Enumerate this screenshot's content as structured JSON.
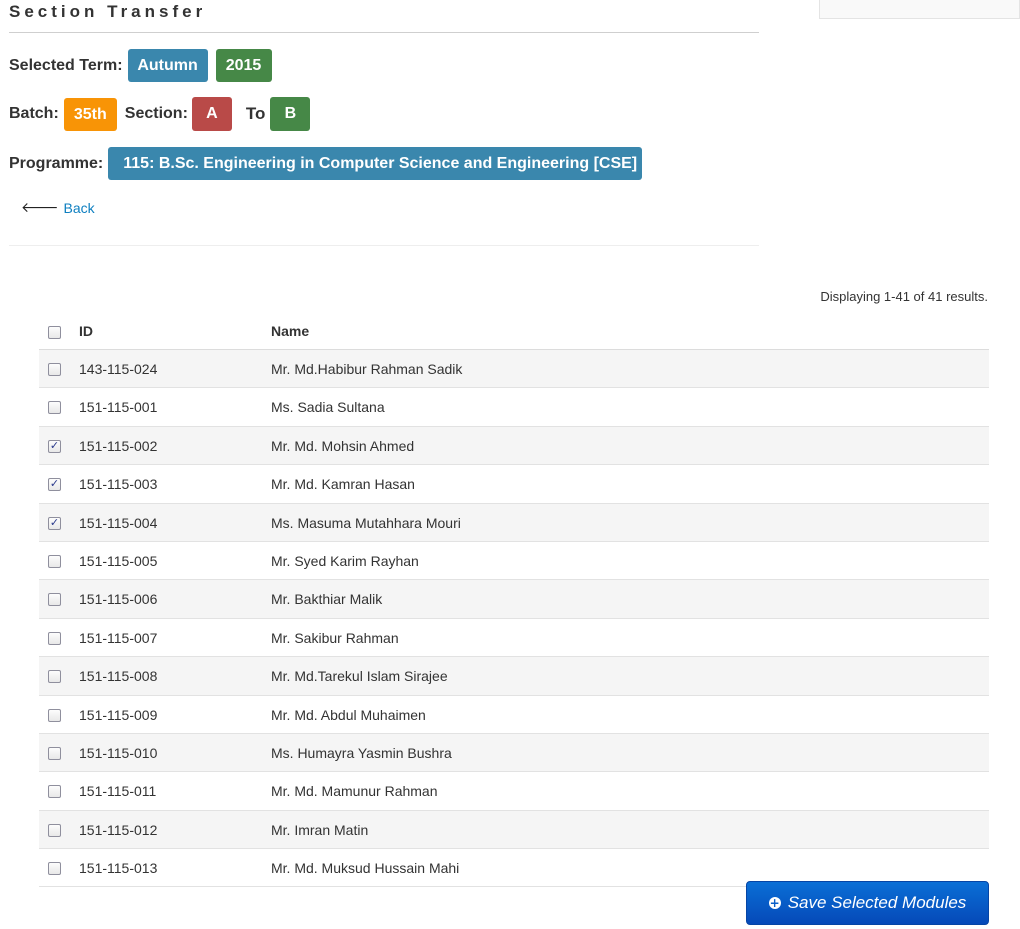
{
  "page": {
    "title": "Section Transfer"
  },
  "term": {
    "label": "Selected Term:",
    "season": "Autumn",
    "year": "2015"
  },
  "batch": {
    "label": "Batch:",
    "value": "35th",
    "section_label": "Section:",
    "section_from": "A",
    "to_label": "To",
    "section_to": "B"
  },
  "programme": {
    "label": "Programme:",
    "value": "115: B.Sc. Engineering in Computer Science and Engineering [CSE]"
  },
  "nav": {
    "back_label": "Back"
  },
  "summary": "Displaying 1-41 of 41 results.",
  "table": {
    "columns": [
      "ID",
      "Name"
    ],
    "rows": [
      {
        "id": "143-115-024",
        "name": "Mr. Md.Habibur Rahman Sadik",
        "checked": false
      },
      {
        "id": "151-115-001",
        "name": "Ms. Sadia Sultana",
        "checked": false
      },
      {
        "id": "151-115-002",
        "name": "Mr. Md. Mohsin Ahmed",
        "checked": true
      },
      {
        "id": "151-115-003",
        "name": "Mr. Md. Kamran Hasan",
        "checked": true
      },
      {
        "id": "151-115-004",
        "name": "Ms. Masuma Mutahhara Mouri",
        "checked": true
      },
      {
        "id": "151-115-005",
        "name": "Mr. Syed Karim Rayhan",
        "checked": false
      },
      {
        "id": "151-115-006",
        "name": "Mr. Bakthiar Malik",
        "checked": false
      },
      {
        "id": "151-115-007",
        "name": "Mr. Sakibur Rahman",
        "checked": false
      },
      {
        "id": "151-115-008",
        "name": "Mr. Md.Tarekul Islam Sirajee",
        "checked": false
      },
      {
        "id": "151-115-009",
        "name": "Mr. Md. Abdul Muhaimen",
        "checked": false
      },
      {
        "id": "151-115-010",
        "name": "Ms. Humayra Yasmin Bushra",
        "checked": false
      },
      {
        "id": "151-115-011",
        "name": "Mr. Md. Mamunur Rahman",
        "checked": false
      },
      {
        "id": "151-115-012",
        "name": "Mr. Imran Matin",
        "checked": false
      },
      {
        "id": "151-115-013",
        "name": "Mr. Md. Muksud Hussain Mahi",
        "checked": false
      }
    ]
  },
  "actions": {
    "save_label": "Save Selected Modules"
  },
  "colors": {
    "info": "#3a87ad",
    "success": "#468847",
    "warning": "#f89406",
    "danger": "#b94a48",
    "primary": "#0a6fd6"
  },
  "icons": {
    "back": "arrow-left-icon",
    "save": "plus-circle-icon",
    "checked": "checkmark-icon"
  }
}
